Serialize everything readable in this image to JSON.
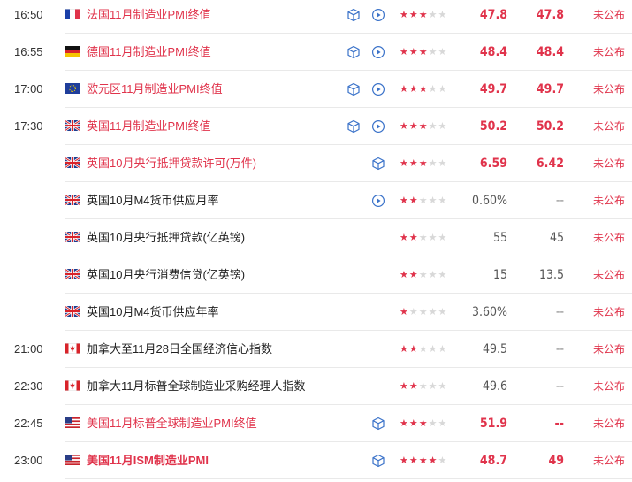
{
  "colors": {
    "highlight": "#e0334b",
    "text": "#222222",
    "muted": "#555555",
    "star_off": "#d8d8d8",
    "icon": "#3a72c9",
    "separator": "#e9e9e9"
  },
  "events": [
    {
      "time": "16:50",
      "flag": "france",
      "name": "法国11月制造业PMI终值",
      "highlight": true,
      "icons": [
        "cube-icon",
        "play-circle-icon"
      ],
      "stars": 3,
      "previous": "47.8",
      "previous_highlight": true,
      "actual": "47.8",
      "actual_highlight": true,
      "status": "未公布"
    },
    {
      "time": "16:55",
      "flag": "germany",
      "name": "德国11月制造业PMI终值",
      "highlight": true,
      "icons": [
        "cube-icon",
        "play-circle-icon"
      ],
      "stars": 3,
      "previous": "48.4",
      "previous_highlight": true,
      "actual": "48.4",
      "actual_highlight": true,
      "status": "未公布"
    },
    {
      "time": "17:00",
      "flag": "eu",
      "name": "欧元区11月制造业PMI终值",
      "highlight": true,
      "icons": [
        "cube-icon",
        "play-circle-icon"
      ],
      "stars": 3,
      "previous": "49.7",
      "previous_highlight": true,
      "actual": "49.7",
      "actual_highlight": true,
      "status": "未公布"
    },
    {
      "time": "17:30",
      "flag": "uk",
      "name": "英国11月制造业PMI终值",
      "highlight": true,
      "icons": [
        "cube-icon",
        "play-circle-icon"
      ],
      "stars": 3,
      "previous": "50.2",
      "previous_highlight": true,
      "actual": "50.2",
      "actual_highlight": true,
      "status": "未公布"
    },
    {
      "time": "",
      "flag": "uk",
      "name": "英国10月央行抵押贷款许可(万件)",
      "highlight": true,
      "icons": [
        "cube-icon"
      ],
      "stars": 3,
      "previous": "6.59",
      "previous_highlight": true,
      "actual": "6.42",
      "actual_highlight": true,
      "status": "未公布"
    },
    {
      "time": "",
      "flag": "uk",
      "name": "英国10月M4货币供应月率",
      "highlight": false,
      "icons": [
        "play-circle-icon"
      ],
      "stars": 2,
      "previous": "0.60%",
      "previous_highlight": false,
      "actual": "--",
      "actual_highlight": false,
      "status": "未公布"
    },
    {
      "time": "",
      "flag": "uk",
      "name": "英国10月央行抵押贷款(亿英镑)",
      "highlight": false,
      "icons": [],
      "stars": 2,
      "previous": "55",
      "previous_highlight": false,
      "actual": "45",
      "actual_highlight": false,
      "status": "未公布"
    },
    {
      "time": "",
      "flag": "uk",
      "name": "英国10月央行消费信贷(亿英镑)",
      "highlight": false,
      "icons": [],
      "stars": 2,
      "previous": "15",
      "previous_highlight": false,
      "actual": "13.5",
      "actual_highlight": false,
      "status": "未公布"
    },
    {
      "time": "",
      "flag": "uk",
      "name": "英国10月M4货币供应年率",
      "highlight": false,
      "icons": [],
      "stars": 1,
      "previous": "3.60%",
      "previous_highlight": false,
      "actual": "--",
      "actual_highlight": false,
      "status": "未公布"
    },
    {
      "time": "21:00",
      "flag": "canada",
      "name": "加拿大至11月28日全国经济信心指数",
      "highlight": false,
      "icons": [],
      "stars": 2,
      "previous": "49.5",
      "previous_highlight": false,
      "actual": "--",
      "actual_highlight": false,
      "status": "未公布"
    },
    {
      "time": "22:30",
      "flag": "canada",
      "name": "加拿大11月标普全球制造业采购经理人指数",
      "highlight": false,
      "icons": [],
      "stars": 2,
      "previous": "49.6",
      "previous_highlight": false,
      "actual": "--",
      "actual_highlight": false,
      "status": "未公布"
    },
    {
      "time": "22:45",
      "flag": "usa",
      "name": "美国11月标普全球制造业PMI终值",
      "highlight": true,
      "icons": [
        "cube-icon"
      ],
      "stars": 3,
      "previous": "51.9",
      "previous_highlight": true,
      "actual": "--",
      "actual_highlight": true,
      "status": "未公布"
    },
    {
      "time": "23:00",
      "flag": "usa",
      "name": "美国11月ISM制造业PMI",
      "highlight": true,
      "bold": true,
      "icons": [
        "cube-icon"
      ],
      "stars": 4,
      "previous": "48.7",
      "previous_highlight": true,
      "actual": "49",
      "actual_highlight": true,
      "status": "未公布"
    }
  ]
}
